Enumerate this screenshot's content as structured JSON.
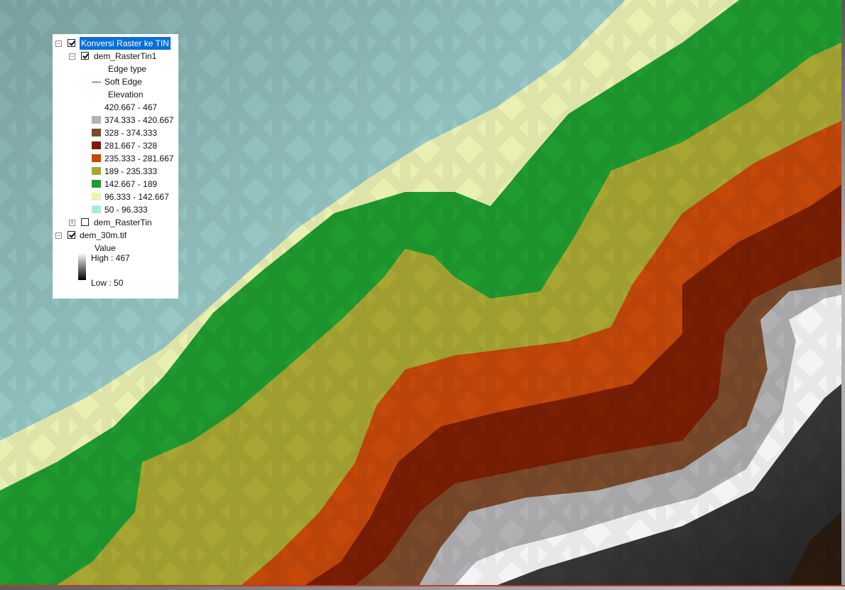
{
  "toc": {
    "group": {
      "label": "Konversi Raster ke TIN",
      "checked": true,
      "expanded": true,
      "selected": true
    },
    "layers": [
      {
        "name": "dem_RasterTin1",
        "checked": true,
        "expanded": true,
        "edge_heading": "Edge type",
        "edge_item": {
          "label": "Soft Edge",
          "color": "#b01e2e"
        },
        "elevation_heading": "Elevation",
        "classes": [
          {
            "label": "420.667 - 467",
            "color": "#ffffff"
          },
          {
            "label": "374.333 - 420.667",
            "color": "#b3b3b5"
          },
          {
            "label": "328 - 374.333",
            "color": "#7a4a2b"
          },
          {
            "label": "281.667 - 328",
            "color": "#7a1e04"
          },
          {
            "label": "235.333 - 281.667",
            "color": "#c4480a"
          },
          {
            "label": "189 - 235.333",
            "color": "#a8a633"
          },
          {
            "label": "142.667 - 189",
            "color": "#1f9b2f"
          },
          {
            "label": "96.333 - 142.667",
            "color": "#ecf2b3"
          },
          {
            "label": "50 - 96.333",
            "color": "#ace8e3"
          }
        ]
      },
      {
        "name": "dem_RasterTin",
        "checked": false,
        "expanded": false
      },
      {
        "name": "dem_30m.tif",
        "checked": true,
        "expanded": true,
        "value_heading": "Value",
        "high_label": "High : 467",
        "low_label": "Low : 50"
      }
    ]
  }
}
